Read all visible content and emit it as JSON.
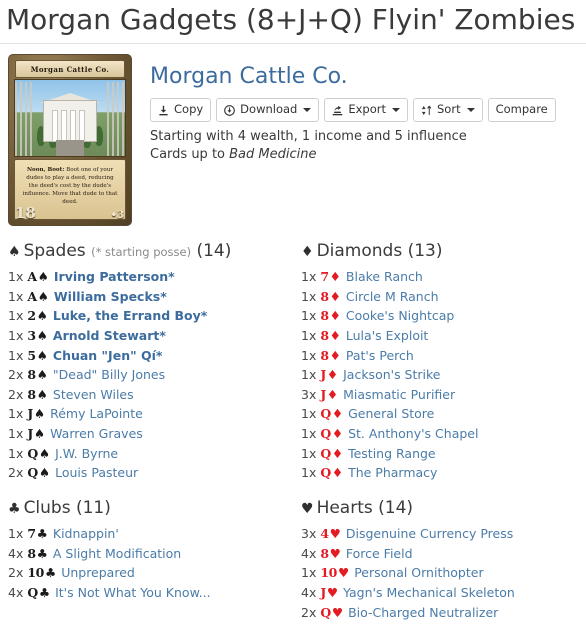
{
  "page": {
    "title": "Morgan Gadgets (8+J+Q) Flyin' Zombies"
  },
  "deck": {
    "name": "Morgan Cattle Co.",
    "starting_line": "Starting with 4 wealth, 1 income and 5 influence",
    "cards_up_to_prefix": "Cards up to ",
    "cards_up_to_value": "Bad Medicine",
    "card_image": {
      "title": "Morgan Cattle Co.",
      "ability_bold": "Noon, Boot:",
      "ability_text": " Boot one of your dudes to play a deed, reducing the deed's cost by the dude's influence. Move that dude to that deed.",
      "value": "18",
      "influence": "•3"
    }
  },
  "toolbar": {
    "copy_label": "Copy",
    "download_label": "Download",
    "export_label": "Export",
    "sort_label": "Sort",
    "compare_label": "Compare"
  },
  "sections": [
    {
      "suit": "Spades",
      "glyph": "♠",
      "color": "black",
      "note": "(* starting posse)",
      "count": "(14)",
      "cards": [
        {
          "qty": "1x",
          "rank": "A",
          "name": "Irving Patterson*",
          "starter": true
        },
        {
          "qty": "1x",
          "rank": "A",
          "name": "William Specks*",
          "starter": true
        },
        {
          "qty": "1x",
          "rank": "2",
          "name": "Luke, the Errand Boy*",
          "starter": true
        },
        {
          "qty": "1x",
          "rank": "3",
          "name": "Arnold Stewart*",
          "starter": true
        },
        {
          "qty": "1x",
          "rank": "5",
          "name": "Chuan \"Jen\" Qí*",
          "starter": true
        },
        {
          "qty": "2x",
          "rank": "8",
          "name": "\"Dead\" Billy Jones",
          "starter": false
        },
        {
          "qty": "2x",
          "rank": "8",
          "name": "Steven Wiles",
          "starter": false
        },
        {
          "qty": "1x",
          "rank": "J",
          "name": "Rémy LaPointe",
          "starter": false
        },
        {
          "qty": "1x",
          "rank": "J",
          "name": "Warren Graves",
          "starter": false
        },
        {
          "qty": "1x",
          "rank": "Q",
          "name": "J.W. Byrne",
          "starter": false
        },
        {
          "qty": "2x",
          "rank": "Q",
          "name": "Louis Pasteur",
          "starter": false
        }
      ]
    },
    {
      "suit": "Diamonds",
      "glyph": "♦",
      "color": "red",
      "note": "",
      "count": "(13)",
      "cards": [
        {
          "qty": "1x",
          "rank": "7",
          "name": "Blake Ranch",
          "starter": false
        },
        {
          "qty": "1x",
          "rank": "8",
          "name": "Circle M Ranch",
          "starter": false
        },
        {
          "qty": "1x",
          "rank": "8",
          "name": "Cooke's Nightcap",
          "starter": false
        },
        {
          "qty": "1x",
          "rank": "8",
          "name": "Lula's Exploit",
          "starter": false
        },
        {
          "qty": "1x",
          "rank": "8",
          "name": "Pat's Perch",
          "starter": false
        },
        {
          "qty": "1x",
          "rank": "J",
          "name": "Jackson's Strike",
          "starter": false
        },
        {
          "qty": "3x",
          "rank": "J",
          "name": "Miasmatic Purifier",
          "starter": false
        },
        {
          "qty": "1x",
          "rank": "Q",
          "name": "General Store",
          "starter": false
        },
        {
          "qty": "1x",
          "rank": "Q",
          "name": "St. Anthony's Chapel",
          "starter": false
        },
        {
          "qty": "1x",
          "rank": "Q",
          "name": "Testing Range",
          "starter": false
        },
        {
          "qty": "1x",
          "rank": "Q",
          "name": "The Pharmacy",
          "starter": false
        }
      ]
    },
    {
      "suit": "Clubs",
      "glyph": "♣",
      "color": "black",
      "note": "",
      "count": "(11)",
      "cards": [
        {
          "qty": "1x",
          "rank": "7",
          "name": "Kidnappin'",
          "starter": false
        },
        {
          "qty": "4x",
          "rank": "8",
          "name": "A Slight Modification",
          "starter": false
        },
        {
          "qty": "2x",
          "rank": "10",
          "name": "Unprepared",
          "starter": false
        },
        {
          "qty": "4x",
          "rank": "Q",
          "name": "It's Not What You Know...",
          "starter": false
        }
      ]
    },
    {
      "suit": "Hearts",
      "glyph": "♥",
      "color": "red",
      "note": "",
      "count": "(14)",
      "cards": [
        {
          "qty": "3x",
          "rank": "4",
          "name": "Disgenuine Currency Press",
          "starter": false
        },
        {
          "qty": "4x",
          "rank": "8",
          "name": "Force Field",
          "starter": false
        },
        {
          "qty": "1x",
          "rank": "10",
          "name": "Personal Ornithopter",
          "starter": false
        },
        {
          "qty": "4x",
          "rank": "J",
          "name": "Yagn's Mechanical Skeleton",
          "starter": false
        },
        {
          "qty": "2x",
          "rank": "Q",
          "name": "Bio-Charged Neutralizer",
          "starter": false
        }
      ]
    }
  ],
  "colors": {
    "link": "#4b7ca8",
    "heading": "#3c6c9e",
    "red_suit": "#e31b23",
    "black_suit": "#1b1b1b",
    "muted": "#8a8a8a"
  }
}
